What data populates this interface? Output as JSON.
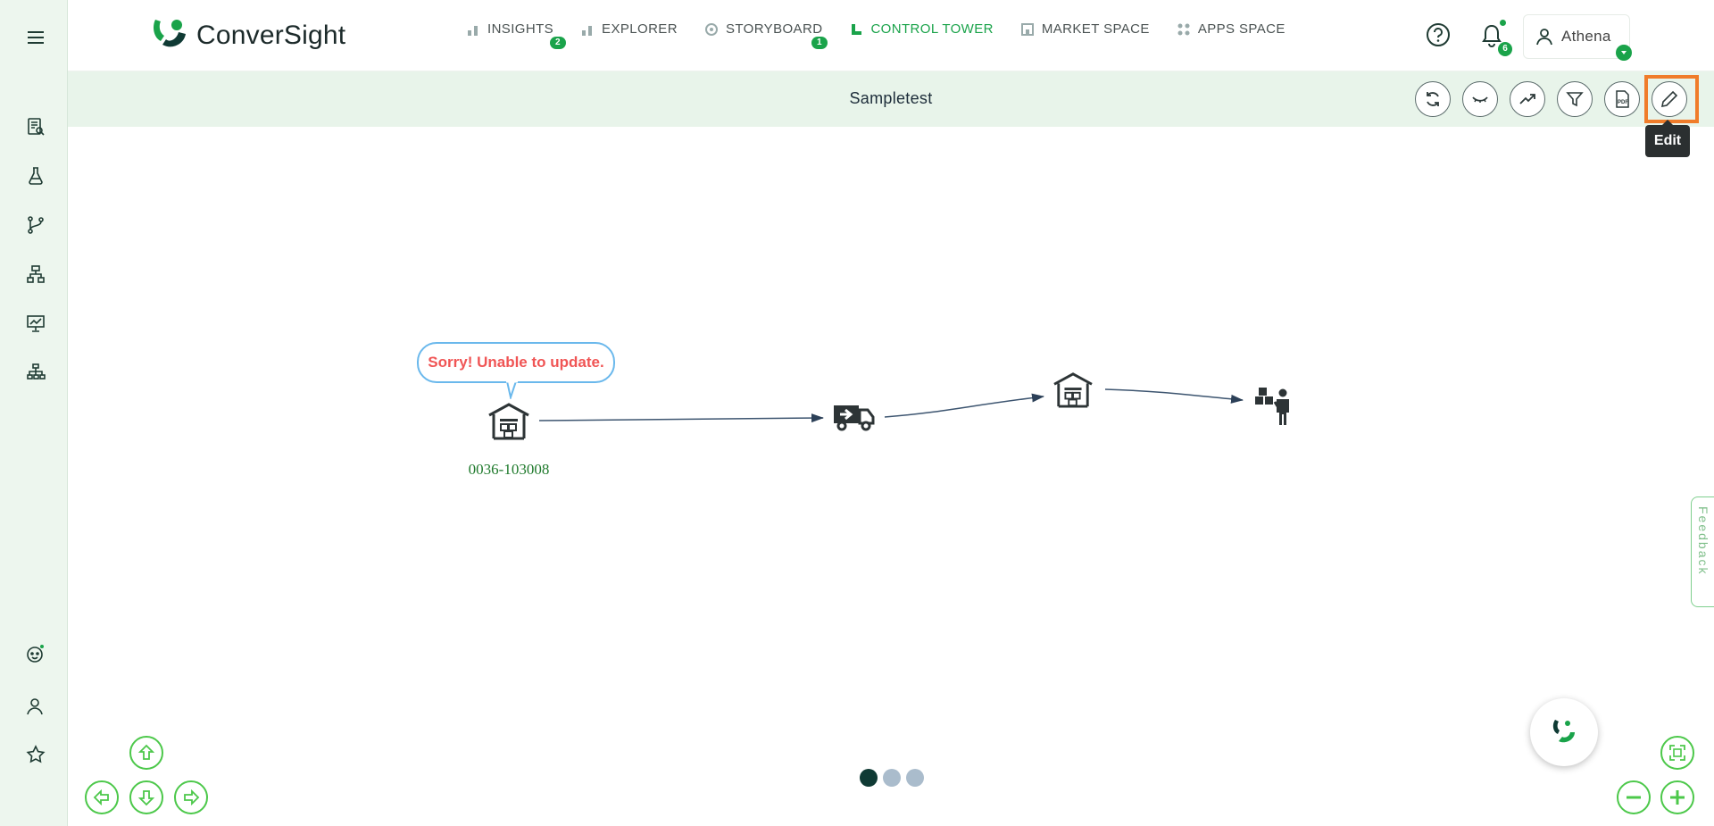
{
  "header": {
    "logo_text": "ConverSight",
    "nav": [
      {
        "label": "INSIGHTS",
        "badge": "2"
      },
      {
        "label": "EXPLORER"
      },
      {
        "label": "STORYBOARD",
        "badge": "1"
      },
      {
        "label": "CONTROL TOWER",
        "active": true
      },
      {
        "label": "MARKET SPACE"
      },
      {
        "label": "APPS SPACE"
      }
    ],
    "notifications_count": "6",
    "user_name": "Athena"
  },
  "sidebar": {
    "items": [
      "menu-icon",
      "report-icon",
      "flask-icon",
      "branch-icon",
      "hierarchy-icon",
      "presentation-icon",
      "org-chart-icon",
      "assistant-icon",
      "user-icon",
      "star-icon"
    ]
  },
  "page": {
    "title": "Sampletest",
    "toolbar": [
      "refresh-icon",
      "hide-icon",
      "trend-icon",
      "filter-icon",
      "pdf-icon",
      "edit-icon"
    ],
    "pdf_icon_text": "PDF",
    "edit_tooltip": "Edit"
  },
  "flow": {
    "error_message": "Sorry! Unable to update.",
    "nodes": [
      {
        "type": "warehouse",
        "label": "0036-103008"
      },
      {
        "type": "truck",
        "label": ""
      },
      {
        "type": "warehouse",
        "label": ""
      },
      {
        "type": "customer",
        "label": ""
      }
    ]
  },
  "feedback_label": "Feedback",
  "pager": {
    "pages": 3,
    "current": 1
  },
  "colors": {
    "accent": "#1aa34a",
    "highlight": "#f07c2a",
    "error": "#f05555",
    "title_bar": "#e8f4ea"
  }
}
